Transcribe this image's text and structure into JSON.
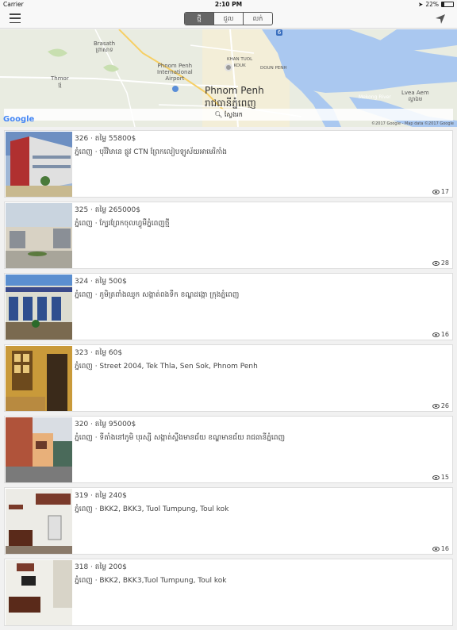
{
  "status": {
    "carrier": "Carrier",
    "time": "2:10 PM",
    "battery": "22%",
    "battery_level": 0.22
  },
  "nav": {
    "tabs": [
      {
        "label": "ថ្មី",
        "active": true
      },
      {
        "label": "ជួល",
        "active": false
      },
      {
        "label": "លក់",
        "active": false
      }
    ]
  },
  "map": {
    "labels": {
      "brasath": "Brasath\nព្រាសាទ",
      "thmor": "Thmor\nថ្ម",
      "airport": "Phnom Penh\nInternational\nAirport",
      "khan_tuol_kouk": "KHAN TUOL\nKOUK",
      "doun_penh": "DOUN PENH",
      "city_en": "Phnom Penh",
      "city_km": "រាជធានីភ្នំពេញ",
      "mekong": "Mekong River",
      "lvea_aem": "Lvea Aem\nល្វាឯម",
      "road": "6"
    },
    "search_label": "ស្វែងរក",
    "google": "Google",
    "copyright": "©2017 Google - Map data ©2017 Google"
  },
  "listings": [
    {
      "header": "326 · តម្លៃ 55800$",
      "location": "ភ្នំពេញ ·  បុរីវិមានេ ផ្លូវ CTN ព្រែកលៀបឡូស័យអាមេរិកាំង",
      "views": "17"
    },
    {
      "header": "325 · តម្លៃ 265000$",
      "location": "ភ្នំពេញ · ក្បែរព្រែកចុលហ្វូមឺភ្នំពេញថ្មី",
      "views": "28"
    },
    {
      "header": "324 · តម្លៃ 500$",
      "location": "ភ្នំពេញ · ភូមិត្រពាំងឈូក សង្កាត់ពងទឹក ខណ្ឌដង្កោ ក្រុងភ្នំពេញ",
      "views": "16"
    },
    {
      "header": "323 · តម្លៃ 60$",
      "location": "ភ្នំពេញ · Street 2004, Tek Thla, Sen Sok, Phnom Penh",
      "views": "26"
    },
    {
      "header": "320 · តម្លៃ 95000$",
      "location": "ភ្នំពេញ · ទីតាំងនៅភូមិ បុរស្សី សង្កាត់ស្ទឹងមានជ័យ ខណ្ឌមានជ័យ រាជធានីភ្នំពេញ",
      "views": "15"
    },
    {
      "header": "319 · តម្លៃ 240$",
      "location": "ភ្នំពេញ · BKK2, BKK3, Tuol Tumpung, Toul kok",
      "views": "16"
    },
    {
      "header": "318 · តម្លៃ 200$",
      "location": "ភ្នំពេញ · BKK2, BKK3,Tuol Tumpung, Toul kok",
      "views": ""
    }
  ],
  "colors": {
    "river": "#aac8f0",
    "land": "#e9ece1",
    "accent": "#666666"
  }
}
